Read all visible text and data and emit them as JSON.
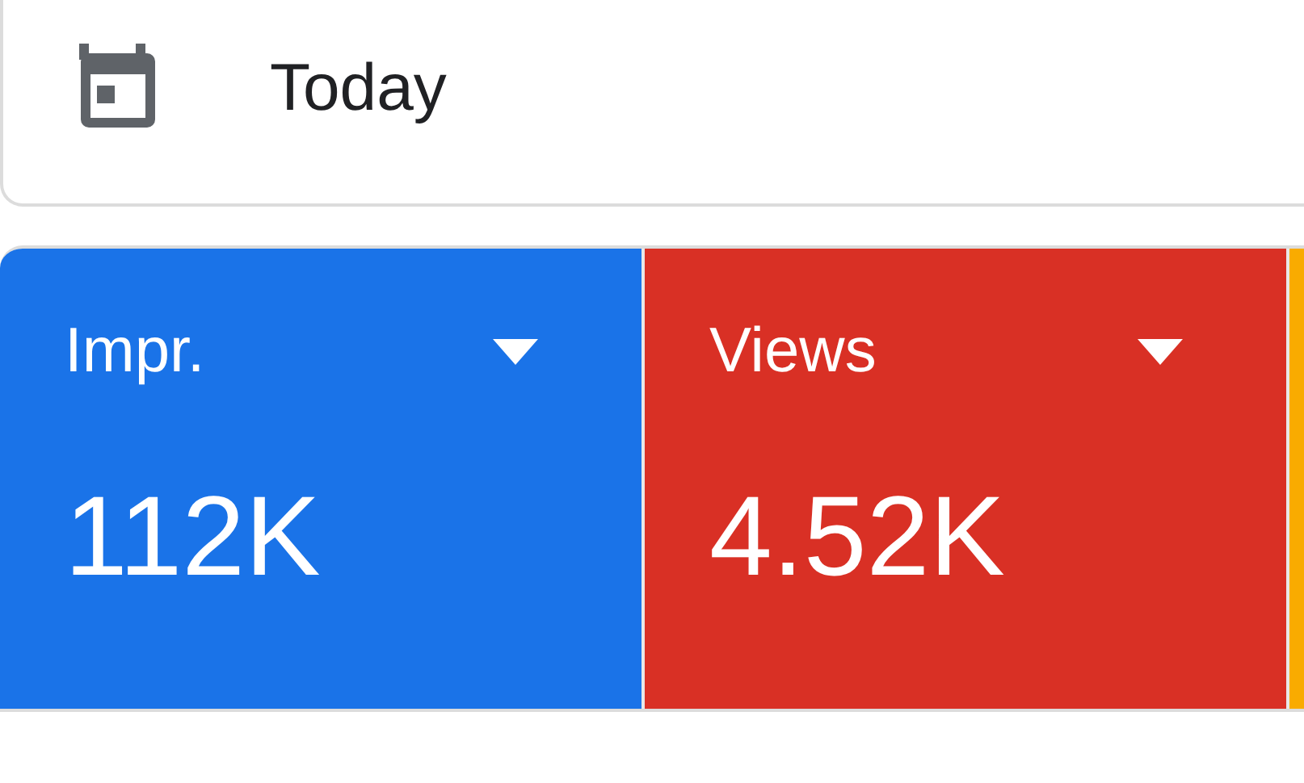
{
  "date_range": {
    "label": "Today"
  },
  "metrics": [
    {
      "label": "Impr.",
      "value": "112K",
      "color": "#1a73e8"
    },
    {
      "label": "Views",
      "value": "4.52K",
      "color": "#d93025"
    },
    {
      "color": "#f9ab00"
    }
  ]
}
